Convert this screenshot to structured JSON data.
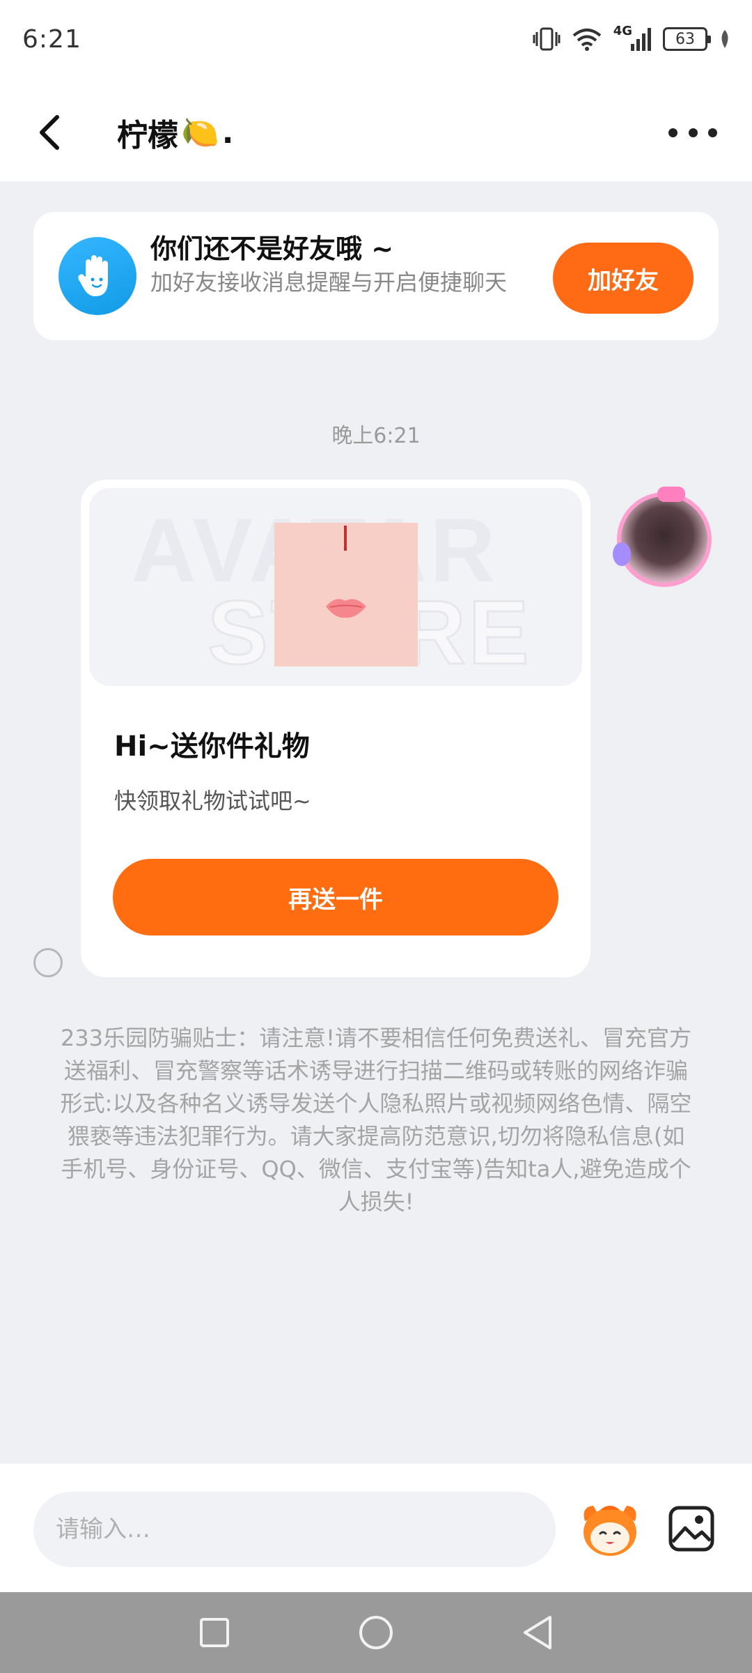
{
  "status_bar": {
    "time": "6:21",
    "network": "4G",
    "battery": "63",
    "icons": [
      "vibrate-icon",
      "wifi-icon",
      "signal-icon",
      "battery-icon",
      "leaf-icon"
    ]
  },
  "header": {
    "title": "柠檬",
    "title_emoji": "🍋",
    "title_suffix": ".",
    "back_icon": "chevron-left-icon",
    "more_icon": "more-dots-icon"
  },
  "friend_banner": {
    "title": "你们还不是好友哦 ~",
    "subtitle": "加好友接收消息提醒与开启便捷聊天",
    "button_label": "加好友",
    "icon": "hand-wave-icon"
  },
  "chat": {
    "timestamp": "晚上6:21",
    "gift_card": {
      "watermark_line1": "AVATAR",
      "watermark_line2": "STORE",
      "title": "Hi~送你件礼物",
      "description": "快领取礼物试试吧~",
      "button_label": "再送一件"
    }
  },
  "notice": "233乐园防骗贴士：请注意!请不要相信任何免费送礼、冒充官方送福利、冒充警察等话术诱导进行扫描二维码或转账的网络诈骗形式:以及各种名义诱导发送个人隐私照片或视频网络色情、隔空猥亵等违法犯罪行为。请大家提高防范意识,切勿将隐私信息(如手机号、身份证号、QQ、微信、支付宝等)告知ta人,避免造成个人损失!",
  "input_bar": {
    "placeholder": "请输入…",
    "mascot_icon": "mascot-emoji-icon",
    "image_icon": "image-icon"
  },
  "nav_bar": {
    "icons": [
      "recent-apps-icon",
      "home-icon",
      "back-triangle-icon"
    ]
  },
  "colors": {
    "accent": "#ff6a14",
    "background": "#eef0f3",
    "friend_icon": "#129be6"
  }
}
